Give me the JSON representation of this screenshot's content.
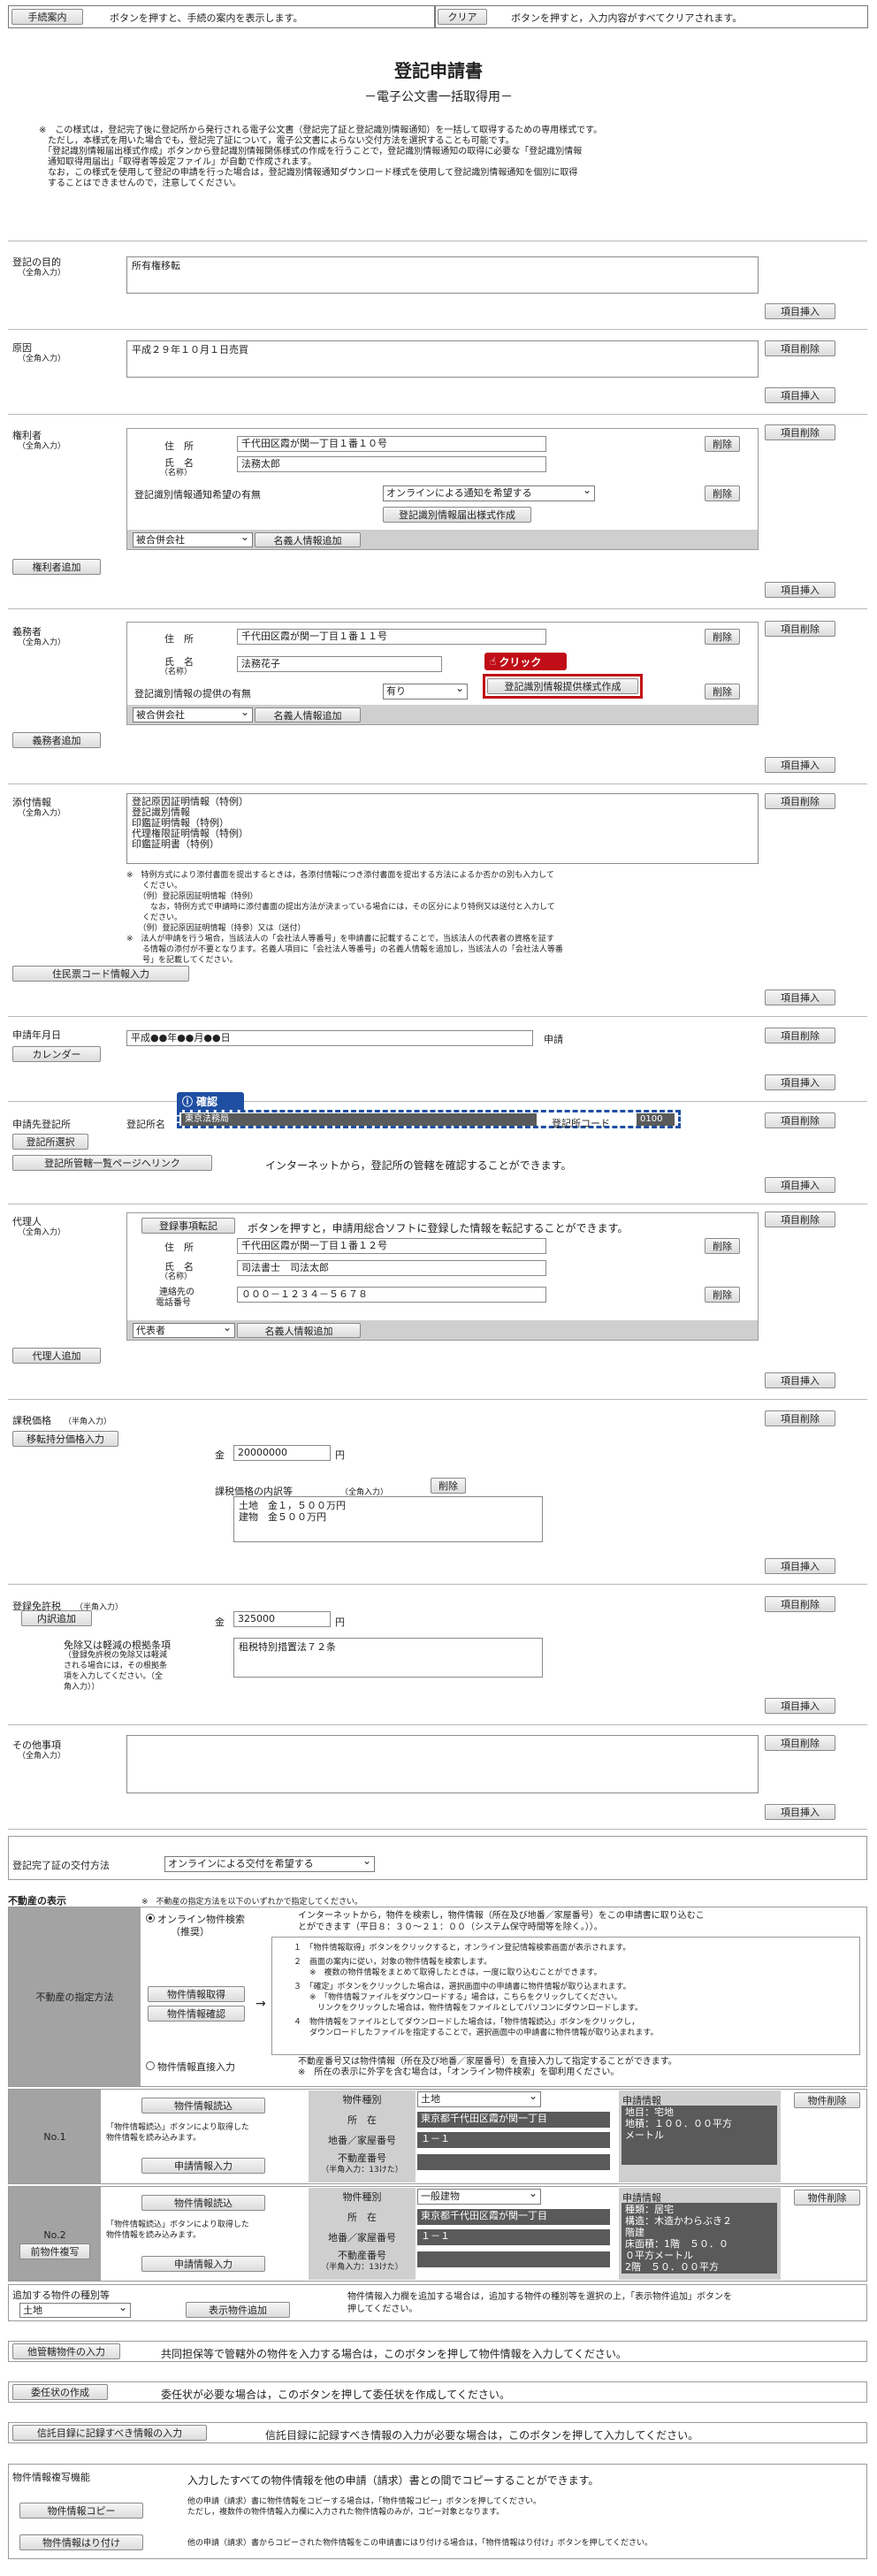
{
  "top": {
    "guide_button": "手続案内",
    "guide_desc": "ボタンを押すと、手続の案内を表示します。",
    "clear_button": "クリア",
    "clear_desc": "ボタンを押すと，入力内容がすべてクリアされます。"
  },
  "header": {
    "title": "登記申請書",
    "subtitle": "－電子公文書一括取得用－"
  },
  "notice": [
    "※　この様式は，登記完了後に登記所から発行される電子公文書（登記完了証と登記識別情報通知）を一括して取得するための専用様式です。",
    "　ただし，本様式を用いた場合でも，登記完了証について，電子公文書によらない交付方法を選択することも可能です。",
    "　「登記識別情報届出様式作成」ボタンから登記識別情報関係様式の作成を行うことで，登記識別情報通知の取得に必要な「登記識別情報",
    "　通知取得用届出」「取得者等設定ファイル」が自動で作成されます。",
    "　なお，この様式を使用して登記の申請を行った場合は，登記識別情報通知ダウンロード様式を使用して登記識別情報通知を個別に取得",
    "　することはできませんので，注意してください。"
  ],
  "common": {
    "item_delete": "項目削除",
    "item_insert": "項目挿入",
    "delete": "削除"
  },
  "purpose": {
    "label": "登記の目的",
    "sub": "（全角入力）",
    "value": "所有権移転"
  },
  "cause": {
    "label": "原因",
    "sub": "（全角入力）",
    "value": "平成２９年１０月１日売買"
  },
  "holder": {
    "label": "権利者",
    "sub": "（全角入力）",
    "address_label": "住　所",
    "address": "千代田区霞が関一丁目１番１０号",
    "name_label": "氏　名",
    "name_sub": "（名称）",
    "name": "法務太郎",
    "notify_label": "登記識別情報通知希望の有無",
    "notify_value": "オンラインによる通知を希望する",
    "form_button": "登記識別情報届出様式作成",
    "merge_value": "被合併会社",
    "name_add": "名義人情報追加",
    "add_button": "権利者追加"
  },
  "obligor": {
    "label": "義務者",
    "sub": "（全角入力）",
    "address_label": "住　所",
    "address": "千代田区霞が関一丁目１番１１号",
    "name_label": "氏　名",
    "name_sub": "（名称）",
    "name": "法務花子",
    "provide_label": "登記識別情報の提供の有無",
    "provide_value": "有り",
    "form_button": "登記識別情報提供様式作成",
    "click_badge": "クリック",
    "merge_value": "被合併会社",
    "name_add": "名義人情報追加",
    "add_button": "義務者追加"
  },
  "attachments": {
    "label": "添付情報",
    "sub": "（全角入力）",
    "value": "登記原因証明情報（特例）\n登記識別情報\n印鑑証明情報（特例）\n代理権限証明情報（特例）\n印鑑証明書（特例）",
    "notes": [
      "※　特例方式により添付書面を提出するときは，各添付情報につき添付書面を提出する方法によるか否かの別も入力して",
      "　　ください。",
      "　　（例）登記原因証明情報（特例）",
      "　　　なお，特例方式で申請時に添付書面の提出方法が決まっている場合には，その区分により特例又は送付と入力して",
      "　　ください。",
      "　　（例）登記原因証明情報（持参）又は（送付）",
      "※　法人が申請を行う場合，当該法人の「会社法人等番号」を申請書に記載することで，当該法人の代表者の資格を証す",
      "　　る情報の添付が不要となります。名義人項目に「会社法人等番号」の名義人情報を追加し，当該法人の「会社法人等番",
      "　　号」を記載してください。"
    ],
    "button": "住民票コード情報入力"
  },
  "date": {
    "label": "申請年月日",
    "value": "平成●●年●●月●●日",
    "suffix": "申請",
    "calendar": "カレンダー"
  },
  "office": {
    "label": "申請先登記所",
    "select_button": "登記所選択",
    "name_label": "登記所名",
    "name": "東京法務局",
    "code_label": "登記所コード",
    "code": "0100",
    "confirm_badge": "確認",
    "link_button": "登記所管轄一覧ページへリンク",
    "link_desc": "インターネットから，登記所の管轄を確認することができます。"
  },
  "agent": {
    "label": "代理人",
    "sub": "（全角入力）",
    "transfer_button": "登録事項転記",
    "transfer_desc": "ボタンを押すと，申請用総合ソフトに登録した情報を転記することができます。",
    "address_label": "住　所",
    "address": "千代田区霞が関一丁目１番１２号",
    "name_label": "氏　名",
    "name_sub": "（名称）",
    "name": "司法書士　司法太郎",
    "phone_label": "連絡先の",
    "phone_label2": "電話番号",
    "phone": "０００－１２３４－５６７８",
    "role_value": "代表者",
    "name_add": "名義人情報追加",
    "add_button": "代理人追加"
  },
  "tax_base": {
    "label": "課税価格",
    "label_sub": "（半角入力）",
    "button": "移転持分価格入力",
    "kin": "金",
    "value": "20000000",
    "yen": "円",
    "detail_label": "課税価格の内訳等",
    "detail_sub": "（全角入力）",
    "detail_value": "土地　金１，５００万円\n建物　金５００万円"
  },
  "license_tax": {
    "label": "登録免許税",
    "label_sub": "（半角入力）",
    "button": "内訳追加",
    "kin": "金",
    "value": "325000",
    "yen": "円",
    "exempt_label": "免除又は軽減の根拠条項",
    "exempt_sub": [
      "（登録免許税の免除又は軽減",
      "される場合には，その根拠条",
      "項を入力してください。（全",
      "角入力））"
    ],
    "exempt_value": "租税特別措置法７２条"
  },
  "other": {
    "label": "その他事項",
    "sub": "（全角入力）"
  },
  "delivery": {
    "label": "登記完了証の交付方法",
    "value": "オンラインによる交付を希望する"
  },
  "property": {
    "title": "不動産の表示",
    "note": "※　不動産の指定方法を以下のいずれかで指定してください。",
    "method_label": "不動産の指定方法",
    "online_radio": "オンライン物件検索",
    "recommended": "（推奨）",
    "online_desc": [
      "インターネットから，物件を検索し，物件情報（所在及び地番／家屋番号）をこの申請書に取り込むこ",
      "とができます（平日８：３０～２１：００（システム保守時間等を除く。））。"
    ],
    "get_button": "物件情報取得",
    "view_button": "物件情報確認",
    "arrow": "→",
    "steps": [
      "１　「物件情報取得」ボタンをクリックすると，オンライン登記情報検索画面が表示されます。",
      "２　画面の案内に従い，対象の物件情報を検索します。",
      "　　※　複数の物件情報をまとめて取得したときは，一度に取り込むことができます。",
      "３　「確定」ボタンをクリックした場合は，選択画面中の申請書に物件情報が取り込まれます。",
      "　　※　「物件情報ファイルをダウンロードする」場合は，こちらをクリックしてください。",
      "　　　リンクをクリックした場合は，物件情報をファイルとしてパソコンにダウンロードします。",
      "４　物件情報をファイルとしてダウンロードした場合は，「物件情報読込」ボタンをクリックし，",
      "　　ダウンロードしたファイルを指定することで，選択画面中の申請書に物件情報が取り込まれます。"
    ],
    "direct_radio": "物件情報直接入力",
    "direct_desc": [
      "不動産番号又は物件情報（所在及び地番／家屋番号）を直接入力して指定することができます。",
      "※　所在の表示に外字を含む場合は，「オンライン物件検索」を御利用ください。"
    ]
  },
  "items": [
    {
      "no": "No.1",
      "copy_button": "",
      "read_button": "物件情報読込",
      "read_desc": [
        "「物件情報読込」ボタンにより取得した",
        "物件情報を読み込みます。"
      ],
      "apply_button": "申請情報入力",
      "type_label": "物件種別",
      "type_value": "土地",
      "loc_label": "所　在",
      "loc_value": "東京都千代田区霞が関一丁目",
      "num_label": "地番／家屋番号",
      "num_value": "１－１",
      "prop_label": "不動産番号",
      "prop_sub": "（半角入力：13けた）",
      "prop_value": "",
      "info_label": "申請情報",
      "info_value": "地目：宅地\n地積：１００．００平方\nメートル",
      "delete": "物件削除"
    },
    {
      "no": "No.2",
      "copy_button": "前物件複写",
      "read_button": "物件情報読込",
      "read_desc": [
        "「物件情報読込」ボタンにより取得した",
        "物件情報を読み込みます。"
      ],
      "apply_button": "申請情報入力",
      "type_label": "物件種別",
      "type_value": "一般建物",
      "loc_label": "所　在",
      "loc_value": "東京都千代田区霞が関一丁目",
      "num_label": "地番／家屋番号",
      "num_value": "１－１",
      "prop_label": "不動産番号",
      "prop_sub": "（半角入力：13けた）",
      "prop_value": "",
      "info_label": "申請情報",
      "info_value": "種類：居宅\n構造：木造かわらぶき２\n階建\n床面積：1階　５０．０\n０平方メートル\n2階　５０．００平方",
      "delete": "物件削除"
    }
  ],
  "add_prop": {
    "label": "追加する物件の種別等",
    "value": "土地",
    "button": "表示物件追加",
    "desc": [
      "物件情報入力欄を追加する場合は，追加する物件の種別等を選択の上，「表示物件追加」ボタンを",
      "押してください。"
    ]
  },
  "other_jurisdiction": {
    "button": "他管轄物件の入力",
    "desc": "共同担保等で管轄外の物件を入力する場合は，このボタンを押して物件情報を入力してください。"
  },
  "power": {
    "button": "委任状の作成",
    "desc": "委任状が必要な場合は，このボタンを押して委任状を作成してください。"
  },
  "trust": {
    "button": "信託目録に記録すべき情報の入力",
    "desc": "信託目録に記録すべき情報の入力が必要な場合は，このボタンを押して入力してください。"
  },
  "copy_func": {
    "label": "物件情報複写機能",
    "desc": "入力したすべての物件情報を他の申請（請求）書との間でコピーすることができます。",
    "copy_button": "物件情報コピー",
    "copy_desc": [
      "他の申請（請求）書に物件情報をコピーする場合は，「物件情報コピー」ボタンを押してください。",
      "ただし，複数件の物件情報入力欄に入力された物件情報のみが，コピー対象となります。"
    ],
    "paste_button": "物件情報はり付け",
    "paste_desc": "他の申請（請求）書からコピーされた物件情報をこの申請書にはり付ける場合は，「物件情報はり付け」ボタンを押してください。"
  }
}
